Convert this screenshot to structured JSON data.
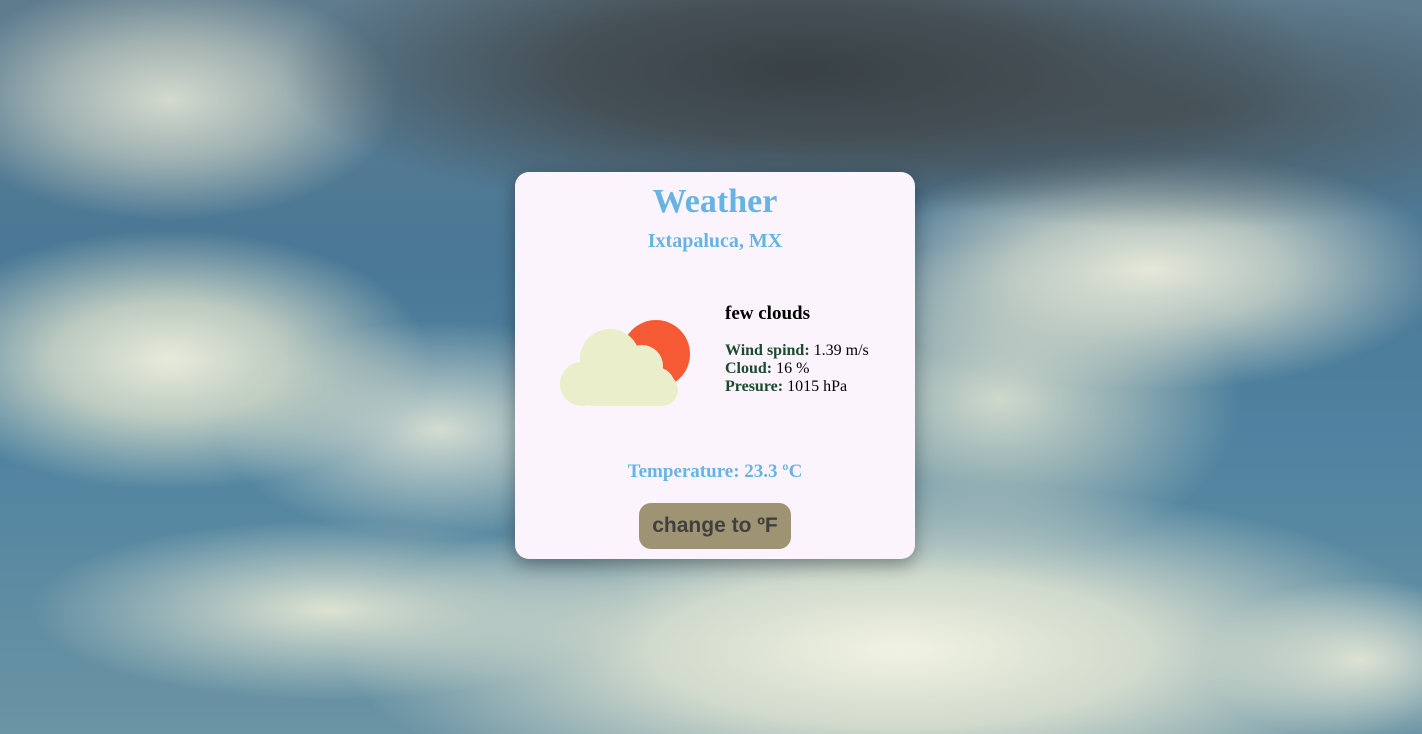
{
  "card": {
    "title": "Weather",
    "location": "Ixtapaluca, MX"
  },
  "conditions": {
    "icon": "few-clouds-icon",
    "description": "few clouds",
    "wind": {
      "label": "Wind spind:",
      "value": "1.39 m/s"
    },
    "cloud": {
      "label": "Cloud:",
      "value": "16 %"
    },
    "pressure": {
      "label": "Presure:",
      "value": "1015 hPa"
    }
  },
  "temperature": {
    "text": "Temperature: 23.3 ºC"
  },
  "unit_toggle": {
    "label": "change to ºF"
  },
  "colors": {
    "accent": "#67b4e4",
    "card_background": "#fbf4fc",
    "button_background": "#9e9474",
    "label_green": "#1b4a2c",
    "sun": "#f55a34",
    "cloud": "#ebeecb"
  }
}
